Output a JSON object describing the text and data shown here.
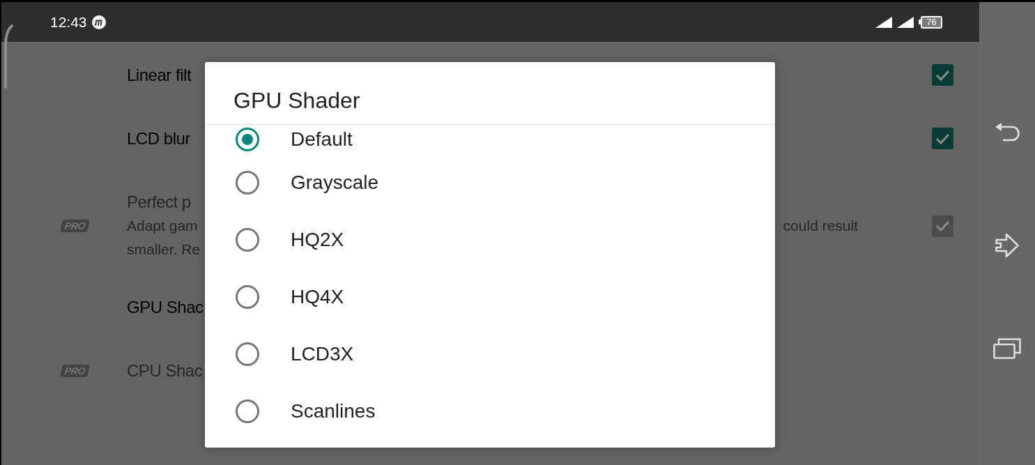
{
  "status_bar": {
    "time": "12:43",
    "battery": "76"
  },
  "settings": [
    {
      "kind": "checkbox",
      "title": "Linear filt",
      "disabled": false,
      "checked": true
    },
    {
      "kind": "checkbox",
      "title": "LCD blur",
      "disabled": false,
      "checked": true
    },
    {
      "kind": "checkbox",
      "badge": "PRO",
      "title": "Perfect p",
      "description": [
        {
          "start": "Adapt gam",
          "end": "could result"
        },
        {
          "start": "smaller. Re"
        }
      ],
      "disabled": true,
      "checked": true
    },
    {
      "kind": "plain",
      "title": "GPU Shac",
      "disabled": false
    },
    {
      "kind": "plain",
      "badge": "PRO",
      "title": "CPU Shac",
      "disabled": true
    }
  ],
  "dialog": {
    "title": "GPU Shader",
    "options": [
      {
        "label": "Default",
        "selected": true
      },
      {
        "label": "Grayscale",
        "selected": false
      },
      {
        "label": "HQ2X",
        "selected": false
      },
      {
        "label": "HQ4X",
        "selected": false
      },
      {
        "label": "LCD3X",
        "selected": false
      },
      {
        "label": "Scanlines",
        "selected": false
      }
    ]
  }
}
